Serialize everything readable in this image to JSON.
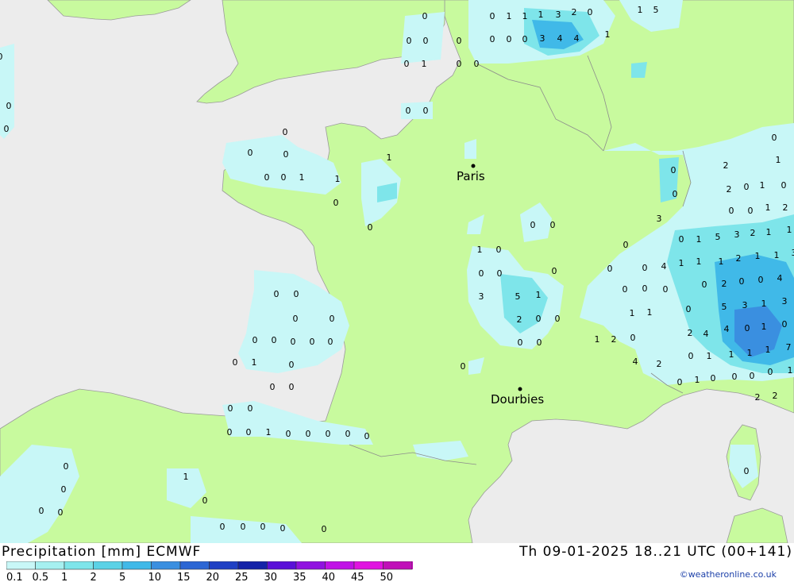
{
  "header": {
    "product": "Precipitation [mm] ECMWF",
    "valid_time": "Th 09-01-2025 18..21 UTC (00+141)",
    "credit": "©weatheronline.co.uk"
  },
  "map": {
    "sea_color": "#ececec",
    "land_color": "#c8fa9e",
    "cities": [
      {
        "name": "Paris"
      },
      {
        "name": "Dourbies"
      }
    ]
  },
  "legend": {
    "labels": [
      "0.1",
      "0.5",
      "1",
      "2",
      "5",
      "10",
      "15",
      "20",
      "25",
      "30",
      "35",
      "40",
      "45",
      "50"
    ],
    "colors": [
      "#c8f7f7",
      "#a6f0f0",
      "#7ee5ea",
      "#5bd2e6",
      "#40b9e8",
      "#3a8fe0",
      "#2c66d4",
      "#1f40c4",
      "#1422a8",
      "#5a10d8",
      "#9012e0",
      "#c012e6",
      "#e014e0",
      "#c010b8"
    ]
  },
  "precip_values": [
    "0",
    "0",
    "1",
    "1",
    "1",
    "3",
    "2",
    "0",
    "1",
    "1",
    "5",
    "0",
    "0",
    "0",
    "0",
    "0",
    "0",
    "3",
    "4",
    "4",
    "1",
    "0",
    "0",
    "0",
    "0",
    "0",
    "0",
    "0",
    "0",
    "0",
    "0",
    "1",
    "1",
    "1",
    "0",
    "0",
    "0",
    "0",
    "0",
    "0",
    "0",
    "2",
    "1",
    "2",
    "0",
    "1",
    "0",
    "0",
    "0",
    "1",
    "2",
    "3",
    "0",
    "1",
    "5",
    "3",
    "2",
    "1",
    "1",
    "0",
    "0",
    "4",
    "1",
    "1",
    "1",
    "2",
    "1",
    "1",
    "3",
    "0",
    "0",
    "0",
    "0",
    "0",
    "2",
    "0",
    "0",
    "4",
    "5",
    "3",
    "1",
    "3",
    "0",
    "1",
    "1",
    "2",
    "4",
    "4",
    "0",
    "1",
    "0",
    "1",
    "2",
    "0",
    "0",
    "1",
    "1",
    "1",
    "1",
    "7",
    "4",
    "2",
    "0",
    "1",
    "0",
    "0",
    "0",
    "0",
    "1",
    "2",
    "2",
    "1",
    "0",
    "0",
    "0",
    "0",
    "3",
    "5",
    "1",
    "2",
    "0",
    "0",
    "0",
    "0",
    "0",
    "0",
    "0",
    "0",
    "0",
    "0",
    "0",
    "0",
    "0",
    "0",
    "0",
    "0",
    "0",
    "1",
    "0",
    "0",
    "0",
    "0",
    "0",
    "0",
    "0",
    "1",
    "0",
    "0",
    "0",
    "0",
    "0",
    "0",
    "0",
    "0",
    "0",
    "1",
    "0",
    "0",
    "0",
    "0",
    "0",
    "0",
    "0",
    "0",
    "1",
    "0"
  ]
}
